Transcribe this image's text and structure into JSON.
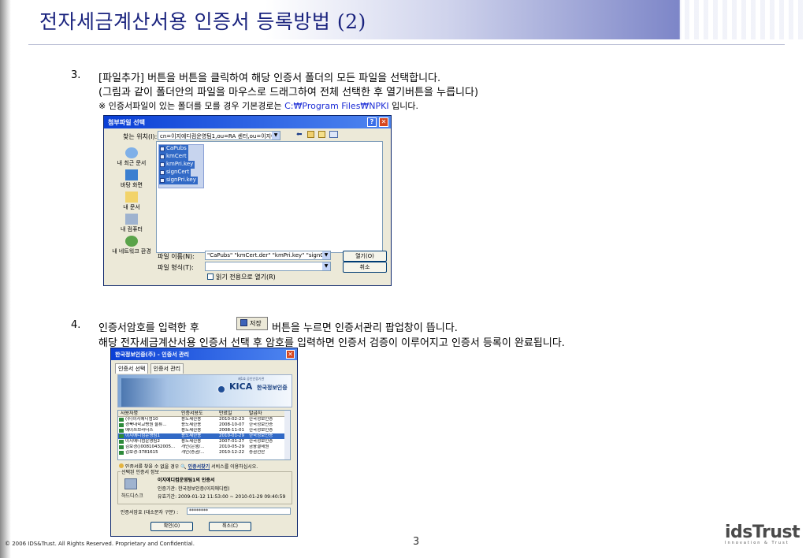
{
  "slide": {
    "title": "전자세금계산서용 인증서 등록방법 (2)",
    "page_number": "3",
    "copyright": "©  2006 IDS&Trust. All Rights Reserved. Proprietary and Confidential.",
    "logo_text": "idsTrust",
    "logo_tagline": "Innovation & Trust"
  },
  "step3": {
    "number": "3.",
    "line1": "[파일추가] 버튼을 버튼을 클릭하여 해당 인증서 폴더의 모든 파일을 선택합니다.",
    "line2": "(그림과 같이 폴더안의 파일을 마우스로 드래그하여 전체 선택한 후 열기버튼을 누릅니다)",
    "note_prefix": "※ 인증서파일이 있는 폴더를 모를 경우 기본경로는",
    "note_path": "C:₩Program Files₩NPKI",
    "note_suffix": "입니다."
  },
  "file_dialog": {
    "title": "첨부파일 선택",
    "look_in_label": "찾는 위치(I):",
    "look_in_value": "cn=이지에디컴운영팀1,ou=RA 센터,ou=이지에디",
    "places": [
      "내 최근 문서",
      "바탕 화면",
      "내 문서",
      "내 컴퓨터",
      "내 네트워크 환경"
    ],
    "files": [
      "CaPubs",
      "kmCert",
      "kmPri.key",
      "signCert",
      "signPri.key"
    ],
    "file_name_label": "파일 이름(N):",
    "file_name_value": "\"CaPubs\" \"kmCert.der\" \"kmPri.key\" \"signCert.de",
    "file_type_label": "파일 형식(T):",
    "read_only_label": "읽기 전용으로 열기(R)",
    "open_button": "열기(O)",
    "cancel_button": "취소",
    "help_glyph": "?",
    "close_glyph": "✕"
  },
  "step4": {
    "number": "4.",
    "line1_before": "인증서암호를 입력한 후",
    "save_button": "저장",
    "line1_after": "버튼을 누르면 인증서관리 팝업창이 뜹니다.",
    "line2": "해당 전자세금계산서용 인증서 선택 후 암호를 입력하면 인증서 검증이 이루어지고 인증서 등록이 완료됩니다."
  },
  "cert_dialog": {
    "title": "한국정보인증(주) - 인증서 관리",
    "tabs": [
      "인증서 선택",
      "인증서 관리"
    ],
    "banner_brand": "KICA",
    "banner_brand_kr": "한국정보인증",
    "banner_top": "제1호 공인인증기관",
    "columns": [
      "사용자명",
      "인증서용도",
      "만료일",
      "발급자"
    ],
    "rows": [
      [
        "(주)이지에디컴10",
        "용도제한용",
        "2010-02-23",
        "한국정보인증"
      ],
      [
        "경북대학교병원 물류...",
        "용도제한용",
        "2008-10-07",
        "한국정보인증"
      ],
      [
        "에이쓰브라더스",
        "용도제한용",
        "2008-11-01",
        "한국정보인증"
      ],
      [
        "이지에디컴운영팀1",
        "용도제한용",
        "2010-01-29",
        "한국정보인증"
      ],
      [
        "이지에디컴운영팀2",
        "용도제한용",
        "2007-01-27",
        "한국정보인증"
      ],
      [
        "김보경()00810432005...",
        "개인(은행/...",
        "2010-05-29",
        "금융결제원"
      ],
      [
        "김보경-3781615",
        "개인(증권/...",
        "2010-12-22",
        "증권전산"
      ]
    ],
    "selected_row": 3,
    "hint_before": "인증서를 찾을 수 없을 경우",
    "hint_link": "인증서찾기",
    "hint_after": "서비스를 이용하십시오.",
    "group_label": "선택된 인증서 정보",
    "storage_label": "하드디스크",
    "cert_name": "이지에디컴운영팀1의 인증서",
    "issuer_line": "인증기관:  한국정보인증(이지에디컴)",
    "validity_line": "유효기간:  2009-01-12 11:53:00 ~ 2010-01-29 09:40:59",
    "password_label": "인증서암호 (대소문자 구분) :",
    "password_value": "********",
    "ok_button": "확인(O)",
    "cancel_button": "취소(C)"
  }
}
